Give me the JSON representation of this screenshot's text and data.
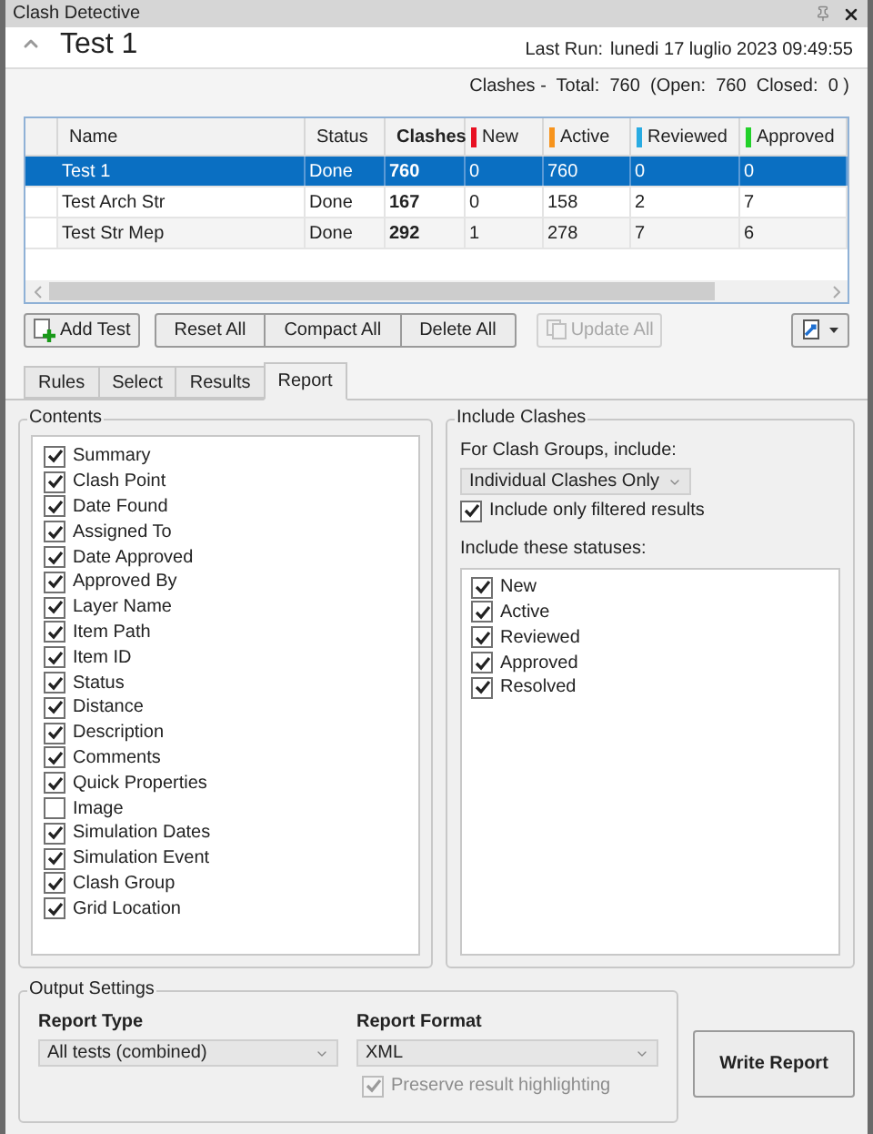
{
  "window": {
    "title": "Clash Detective"
  },
  "header": {
    "title": "Test 1",
    "last_run_label": "Last Run:",
    "last_run": "lunedi 17 luglio 2023 09:49:55",
    "summary": "Clashes -  Total:  760  (Open:  760  Closed:  0 )"
  },
  "table": {
    "columns": [
      {
        "label": "Name",
        "kind": "plain"
      },
      {
        "label": "Status",
        "kind": "plain"
      },
      {
        "label": "Clashes",
        "kind": "bold"
      },
      {
        "label": "New",
        "kind": "status",
        "color": "#e81123"
      },
      {
        "label": "Active",
        "kind": "status",
        "color": "#f7941d"
      },
      {
        "label": "Reviewed",
        "kind": "status",
        "color": "#29abe2"
      },
      {
        "label": "Approved",
        "kind": "status",
        "color": "#22d12a"
      }
    ],
    "rows": [
      {
        "selected": true,
        "cells": [
          "Test 1",
          "Done",
          "760",
          "0",
          "760",
          "0",
          "0"
        ]
      },
      {
        "selected": false,
        "cells": [
          "Test Arch Str",
          "Done",
          "167",
          "0",
          "158",
          "2",
          "7"
        ]
      },
      {
        "selected": false,
        "cells": [
          "Test Str Mep",
          "Done",
          "292",
          "1",
          "278",
          "7",
          "6"
        ]
      }
    ]
  },
  "toolbar": {
    "add": {
      "label": "Add Test",
      "disabled": false
    },
    "group": [
      {
        "label": "Reset All",
        "disabled": false
      },
      {
        "label": "Compact All",
        "disabled": false
      },
      {
        "label": "Delete All",
        "disabled": false
      }
    ],
    "update": {
      "label": "Update All",
      "disabled": true
    }
  },
  "tabs": [
    {
      "label": "Rules",
      "selected": false
    },
    {
      "label": "Select",
      "selected": false
    },
    {
      "label": "Results",
      "selected": false
    },
    {
      "label": "Report",
      "selected": true
    }
  ],
  "contents": {
    "title": "Contents",
    "items": [
      {
        "label": "Summary",
        "checked": true
      },
      {
        "label": "Clash Point",
        "checked": true
      },
      {
        "label": "Date Found",
        "checked": true
      },
      {
        "label": "Assigned To",
        "checked": true
      },
      {
        "label": "Date Approved",
        "checked": true
      },
      {
        "label": "Approved By",
        "checked": true
      },
      {
        "label": "Layer Name",
        "checked": true
      },
      {
        "label": "Item Path",
        "checked": true
      },
      {
        "label": "Item ID",
        "checked": true
      },
      {
        "label": "Status",
        "checked": true
      },
      {
        "label": "Distance",
        "checked": true
      },
      {
        "label": "Description",
        "checked": true
      },
      {
        "label": "Comments",
        "checked": true
      },
      {
        "label": "Quick Properties",
        "checked": true
      },
      {
        "label": "Image",
        "checked": false
      },
      {
        "label": "Simulation Dates",
        "checked": true
      },
      {
        "label": "Simulation Event",
        "checked": true
      },
      {
        "label": "Clash Group",
        "checked": true
      },
      {
        "label": "Grid Location",
        "checked": true
      }
    ]
  },
  "include_clashes": {
    "title": "Include Clashes",
    "groups_label": "For Clash Groups, include:",
    "groups_value": "Individual Clashes Only",
    "filtered": {
      "label": "Include only filtered results",
      "checked": true
    },
    "statuses_label": "Include these statuses:",
    "statuses": [
      {
        "label": "New",
        "checked": true
      },
      {
        "label": "Active",
        "checked": true
      },
      {
        "label": "Reviewed",
        "checked": true
      },
      {
        "label": "Approved",
        "checked": true
      },
      {
        "label": "Resolved",
        "checked": true
      }
    ]
  },
  "output_settings": {
    "title": "Output Settings",
    "report_type_label": "Report Type",
    "report_type": "All tests (combined)",
    "report_format_label": "Report Format",
    "report_format": "XML",
    "preserve": {
      "label": "Preserve result highlighting",
      "checked": true,
      "disabled": true
    }
  },
  "write_button": {
    "label": "Write Report"
  }
}
